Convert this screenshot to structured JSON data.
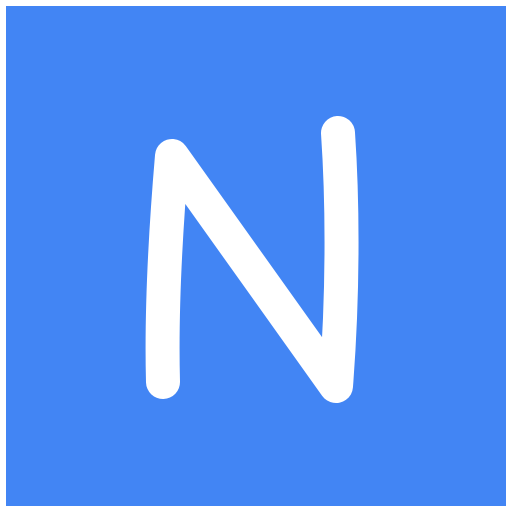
{
  "app_icon": {
    "glyph": "N",
    "glyph_name": "letter-n-glyph",
    "icon_name": "letter-n-app-icon",
    "background_color": "#4285F4",
    "glyph_color": "#FFFFFF"
  }
}
